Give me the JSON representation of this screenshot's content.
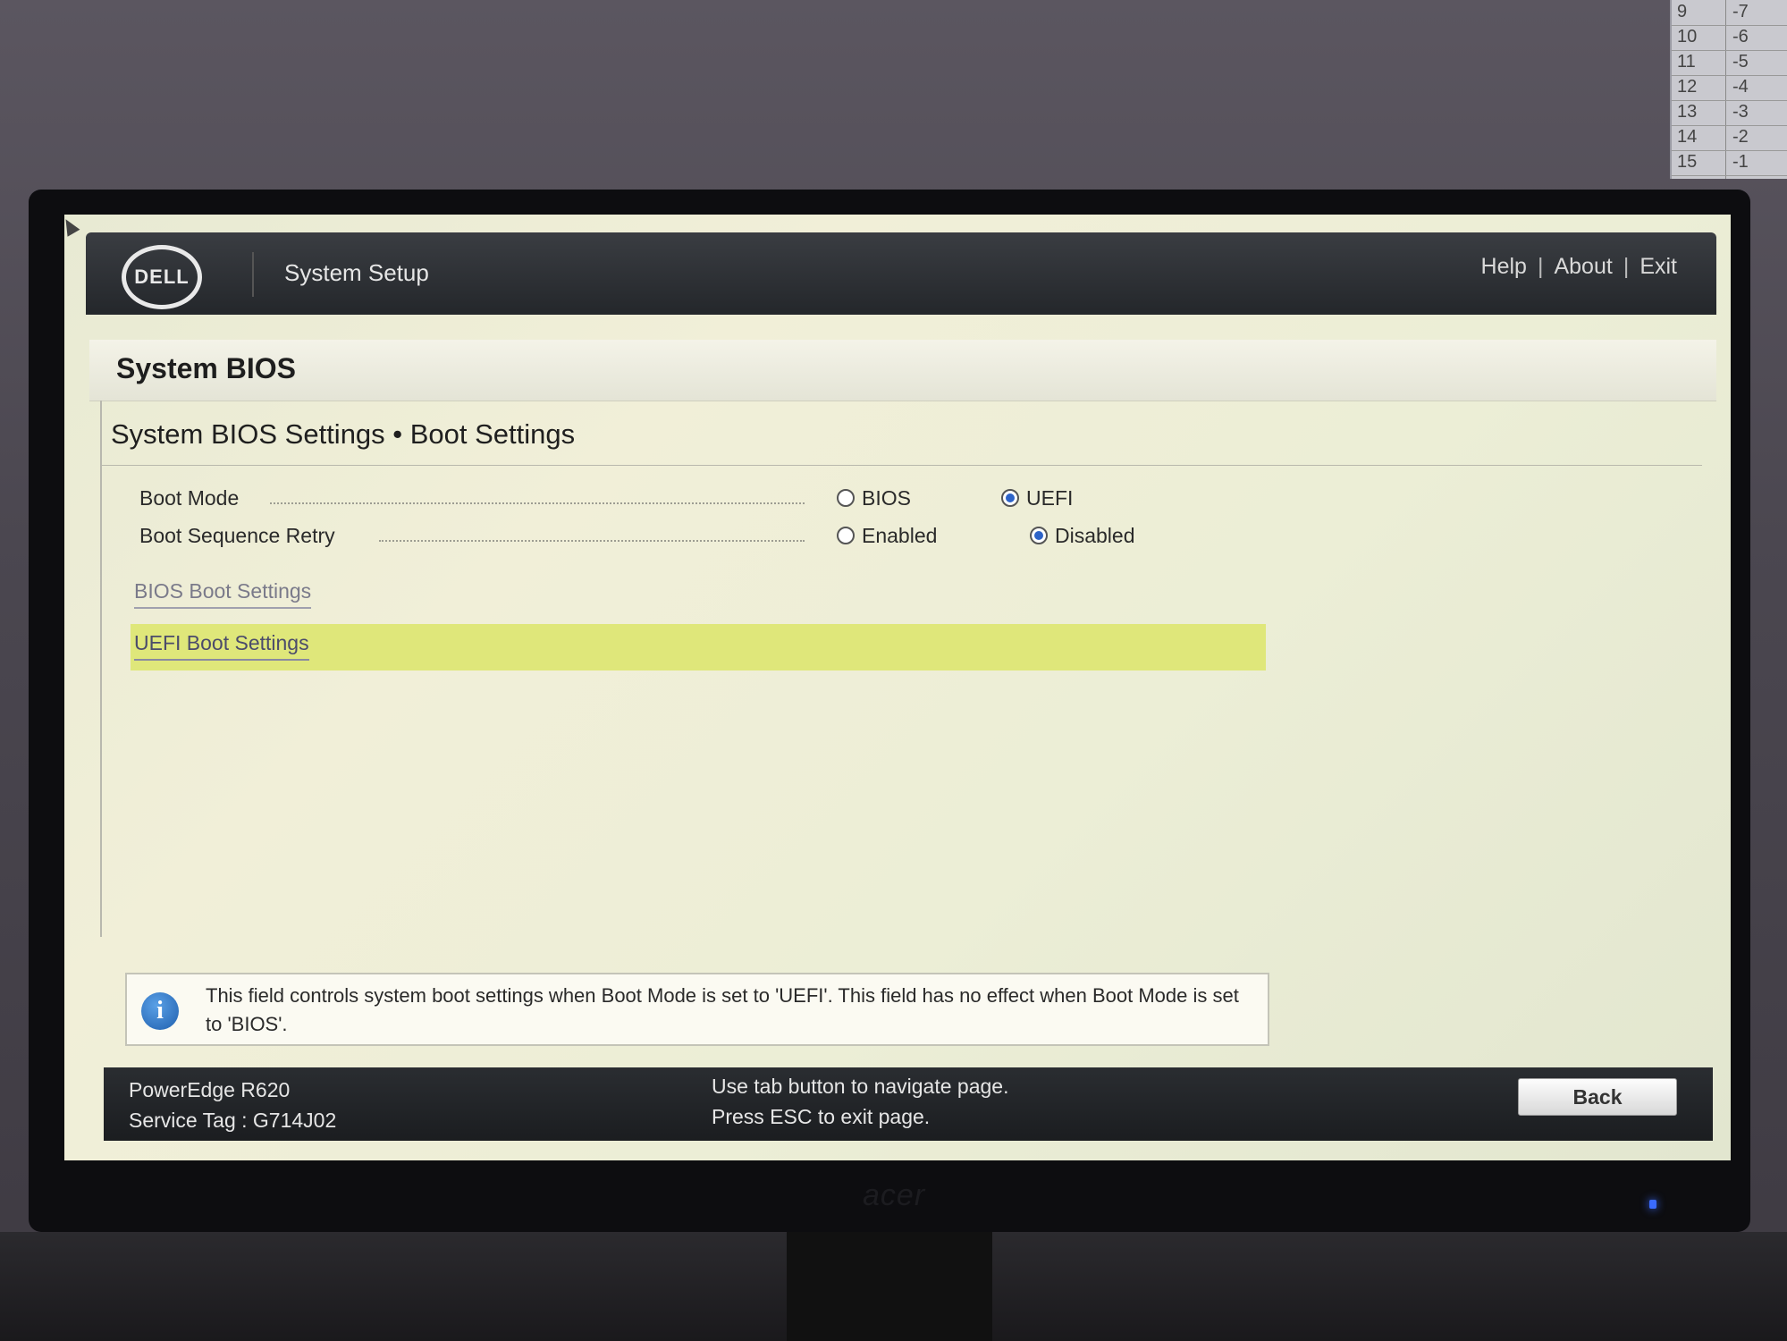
{
  "wall_note": {
    "rows": [
      {
        "a": "9",
        "b": "-7"
      },
      {
        "a": "10",
        "b": "-6"
      },
      {
        "a": "11",
        "b": "-5"
      },
      {
        "a": "12",
        "b": "-4"
      },
      {
        "a": "13",
        "b": "-3"
      },
      {
        "a": "14",
        "b": "-2"
      },
      {
        "a": "15",
        "b": "-1"
      }
    ]
  },
  "monitor": {
    "brand": "acer"
  },
  "header": {
    "logo_text": "DELL",
    "app_title": "System Setup",
    "links": {
      "help": "Help",
      "about": "About",
      "exit": "Exit",
      "separator": "|"
    }
  },
  "page": {
    "title": "System BIOS",
    "section_title": "System BIOS Settings • Boot Settings"
  },
  "fields": {
    "boot_mode": {
      "label": "Boot Mode",
      "options": [
        "BIOS",
        "UEFI"
      ],
      "selected": "UEFI"
    },
    "boot_sequence_retry": {
      "label": "Boot Sequence Retry",
      "options": [
        "Enabled",
        "Disabled"
      ],
      "selected": "Disabled"
    }
  },
  "links": {
    "bios_boot_settings": "BIOS Boot Settings",
    "uefi_boot_settings": "UEFI Boot Settings"
  },
  "info": {
    "icon_glyph": "i",
    "text": "This field controls system boot settings when Boot Mode is set to 'UEFI'. This field has no effect when Boot Mode is set to 'BIOS'."
  },
  "footer": {
    "model": "PowerEdge R620",
    "service_tag": "Service Tag : G714J02",
    "hint_1": "Use tab button to navigate page.",
    "hint_2": "Press ESC to exit page.",
    "back_label": "Back"
  },
  "colors": {
    "highlight": "#dfe77a",
    "header_bg": "#24272b",
    "radio_selected": "#2d63c8"
  }
}
